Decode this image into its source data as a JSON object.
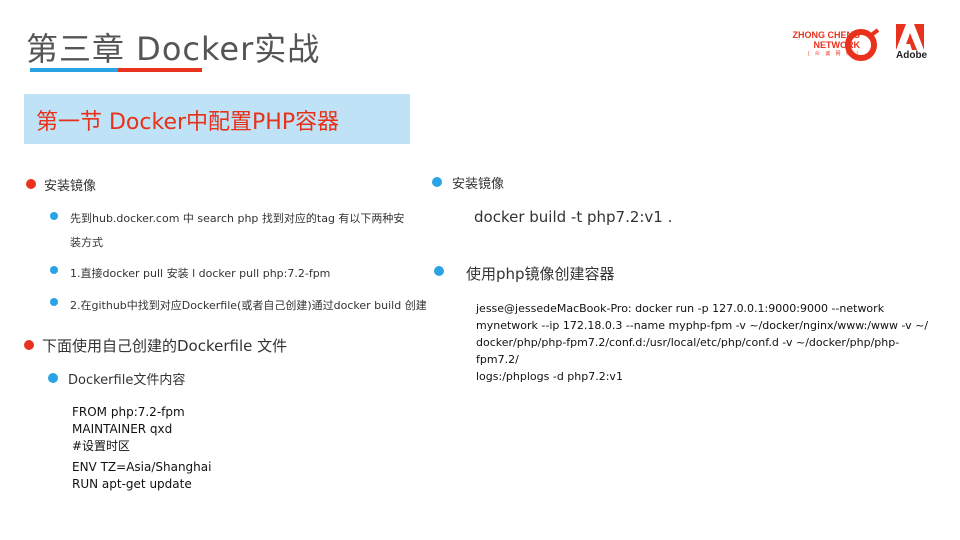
{
  "header": {
    "title": "第三章 Docker实战",
    "logo_zc_line1": "ZHONG CHENG",
    "logo_zc_line2": "NETWORK",
    "logo_zc_sub": "( 众 诚 网 络 )",
    "logo_adobe": "Adobe"
  },
  "section": {
    "title": "第一节 Docker中配置PHP容器"
  },
  "left": {
    "item1": "安装镜像",
    "item1_sub1_line1": "先到hub.docker.com 中 search php 找到对应的tag 有以下两种安",
    "item1_sub1_line2": "装方式",
    "item1_sub2": "1.直接docker pull 安装 l docker pull php:7.2-fpm",
    "item1_sub3": "2.在github中找到对应Dockerfile(或者自己创建)通过docker build 创建",
    "item2": "下面使用自己创建的Dockerfile 文件",
    "item2_sub1": "Dockerfile文件内容",
    "dockerfile": [
      "FROM php:7.2-fpm",
      "MAINTAINER qxd",
      "#设置时区",
      "ENV TZ=Asia/Shanghai",
      "RUN apt-get update"
    ]
  },
  "right": {
    "item1": "安装镜像",
    "build_cmd": "docker build -t php7.2:v1 .",
    "item2": "使用php镜像创建容器",
    "run_cmd": [
      "jesse@jessedeMacBook-Pro: docker run -p 127.0.0.1:9000:9000  --network",
      "mynetwork --ip 172.18.0.3 --name  myphp-fpm -v ~/docker/nginx/www:/www -v ~/",
      "docker/php/php-fpm7.2/conf.d:/usr/local/etc/php/conf.d -v ~/docker/php/php-fpm7.2/",
      "logs:/phplogs   -d php7.2:v1"
    ]
  },
  "colors": {
    "accent_red": "#e8321e",
    "accent_blue": "#2aa3e6",
    "section_bg": "#bfe2f7"
  }
}
